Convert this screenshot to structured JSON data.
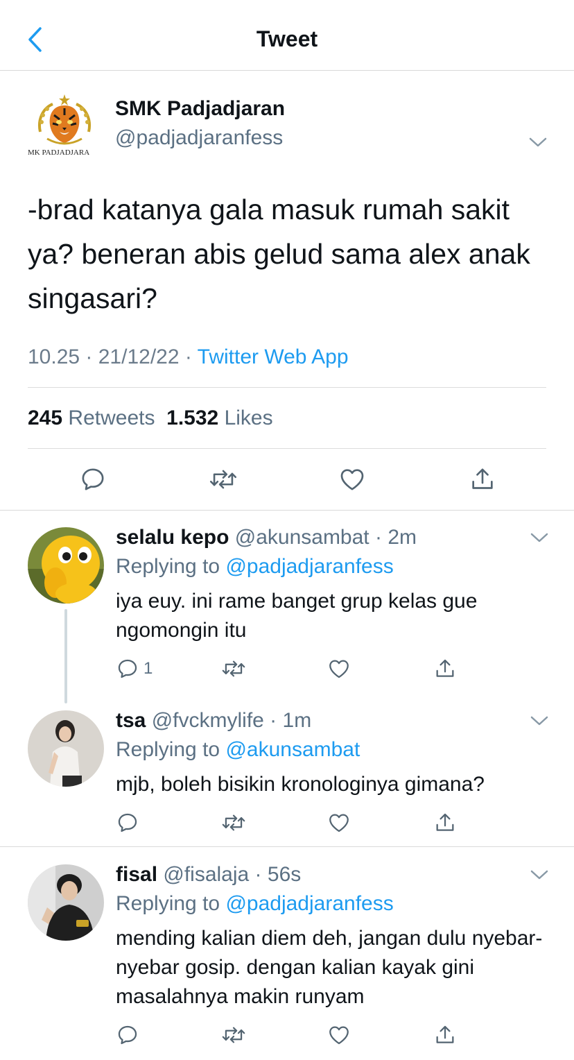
{
  "nav": {
    "title": "Tweet",
    "back_icon": "chevron-left-icon"
  },
  "tweet": {
    "author_name": "SMK Padjadjaran",
    "author_handle": "@padjadjaranfess",
    "logo_text": "MK PADJADJARA",
    "text": "-brad katanya gala masuk rumah sakit ya? beneran abis gelud sama alex anak singasari?",
    "time": "10.25",
    "date": "21/12/22",
    "source": "Twitter Web App",
    "retweets": "245",
    "retweets_label": "Retweets",
    "likes": "1.532",
    "likes_label": "Likes"
  },
  "replies": [
    {
      "name": "selalu kepo",
      "handle": "@akunsambat",
      "time": "2m",
      "replying_label": "Replying to",
      "replying_to": "@padjadjaranfess",
      "text": "iya euy. ini rame banget grup kelas gue ngomongin itu",
      "reply_count": "1"
    },
    {
      "name": "tsa",
      "handle": "@fvckmylife",
      "time": "1m",
      "replying_label": "Replying to",
      "replying_to": "@akunsambat",
      "text": "mjb, boleh bisikin kronologinya gimana?",
      "reply_count": ""
    },
    {
      "name": "fisal",
      "handle": "@fisalaja",
      "time": "56s",
      "replying_label": "Replying to",
      "replying_to": "@padjadjaranfess",
      "text": "mending kalian diem deh, jangan dulu nyebar-nyebar gosip. dengan kalian kayak gini masalahnya makin runyam",
      "reply_count": ""
    }
  ],
  "colors": {
    "link": "#1d9bf0",
    "secondary": "#5b7083",
    "icon": "#536471"
  }
}
